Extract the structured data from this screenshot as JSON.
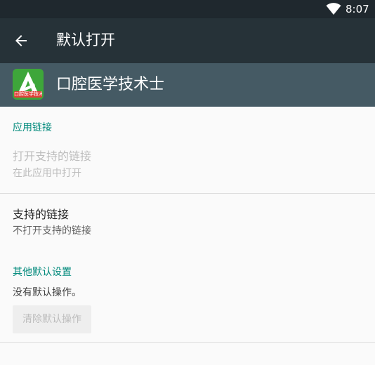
{
  "status_bar": {
    "time": "8:07",
    "wifi_icon": "wifi-icon"
  },
  "toolbar": {
    "back_icon": "arrow-back-icon",
    "title": "默认打开"
  },
  "app": {
    "name": "口腔医学技术士",
    "icon_tag_text": "口腔医学技术",
    "icon_color": "#3ea63a",
    "icon_tag_color": "#e0403a"
  },
  "app_links": {
    "header": "应用链接",
    "open_supported_title": "打开支持的链接",
    "open_supported_summary": "在此应用中打开",
    "supported_links_title": "支持的链接",
    "supported_links_summary": "不打开支持的链接"
  },
  "other_defaults": {
    "header": "其他默认设置",
    "summary": "没有默认操作。",
    "clear_button": "清除默认操作"
  },
  "colors": {
    "status_bar": "#1f282e",
    "toolbar": "#263238",
    "app_header": "#455a64",
    "accent": "#00897b",
    "background": "#fafafa"
  }
}
